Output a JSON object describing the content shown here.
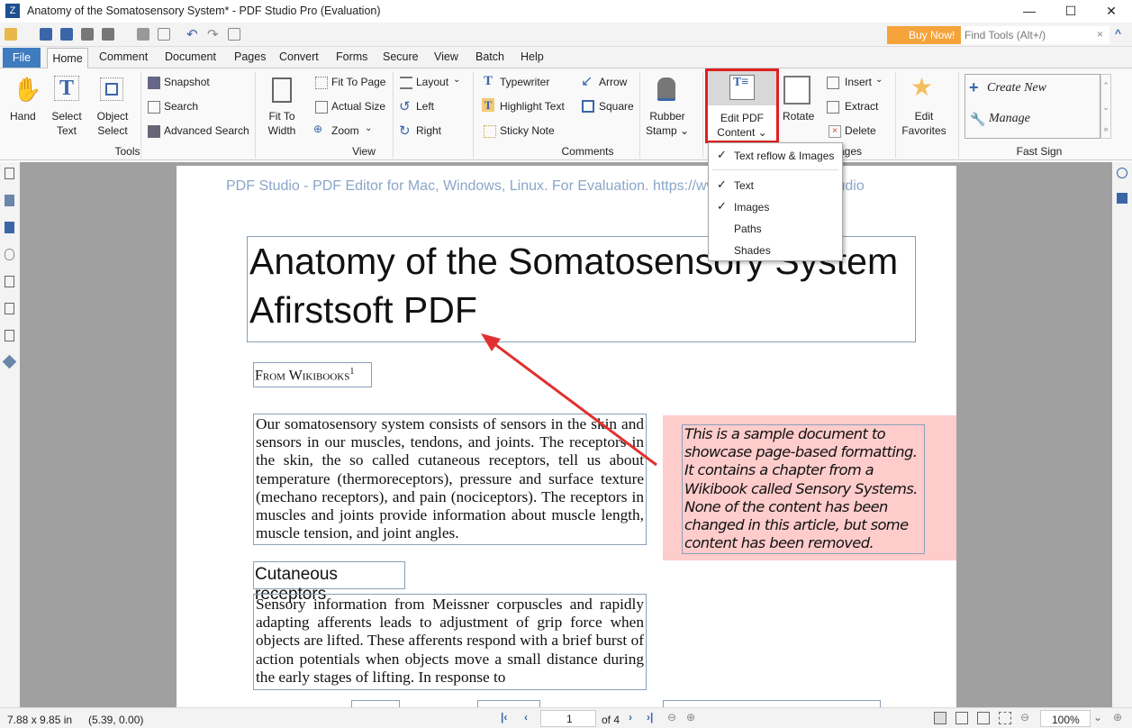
{
  "window": {
    "title": "Anatomy of the Somatosensory System* - PDF Studio Pro (Evaluation)",
    "minimize": "—",
    "maximize": "☐",
    "close": "✕"
  },
  "quick_toolbar": {
    "buy_now": "Buy Now!",
    "find_tools_placeholder": "Find Tools  (Alt+/)",
    "clear": "×",
    "collapse": "^"
  },
  "tabs": [
    "File",
    "Home",
    "Comment",
    "Document",
    "Pages",
    "Convert",
    "Forms",
    "Secure",
    "View",
    "Batch",
    "Help"
  ],
  "ribbon": {
    "tools": {
      "label": "Tools",
      "hand": "Hand",
      "select_text": [
        "Select",
        "Text"
      ],
      "object_select": [
        "Object",
        "Select"
      ],
      "snapshot": "Snapshot",
      "search": "Search",
      "advanced_search": "Advanced Search"
    },
    "view": {
      "label": "View",
      "fit_to_width": [
        "Fit To",
        "Width"
      ],
      "fit_to_page": "Fit To Page",
      "actual_size": "Actual Size",
      "zoom": "Zoom",
      "layout": "Layout",
      "left": "Left",
      "right": "Right"
    },
    "comments": {
      "label": "Comments",
      "typewriter": "Typewriter",
      "highlight_text": "Highlight Text",
      "sticky_note": "Sticky Note",
      "arrow": "Arrow",
      "square": "Square",
      "rubber_stamp": [
        "Rubber",
        "Stamp"
      ]
    },
    "pages": {
      "label": "Pages",
      "edit_pdf_content": [
        "Edit PDF",
        "Content"
      ],
      "rotate": "Rotate",
      "insert": "Insert",
      "extract": "Extract",
      "delete": "Delete",
      "edit_favorites": [
        "Edit",
        "Favorites"
      ]
    },
    "fast_sign": {
      "label": "Fast Sign",
      "create_new": "Create New",
      "manage": "Manage"
    }
  },
  "dropdown": {
    "items": [
      {
        "label": "Text reflow & Images",
        "checked": true
      },
      {
        "label": "Text",
        "checked": true
      },
      {
        "label": "Images",
        "checked": true
      },
      {
        "label": "Paths",
        "checked": false
      },
      {
        "label": "Shades",
        "checked": false
      }
    ]
  },
  "document": {
    "watermark": "PDF Studio - PDF Editor for Mac, Windows, Linux. For Evaluation. https://www.qoppa.com/pdfstudio",
    "title_line1": "Anatomy of the Somatosensory System",
    "title_line2": "Afirstsoft PDF",
    "from": "From Wikibooks",
    "from_sup": "1",
    "para1": "Our somatosensory system consists of sensors in the skin and sensors in our muscles, tendons, and joints. The receptors in the skin, the so called cutaneous receptors, tell us about temperature (thermoreceptors), pressure and surface texture (mechano receptors), and pain (nociceptors). The receptors in muscles and joints provide information about muscle length, muscle tension, and joint angles.",
    "note": "This is a sample document to showcase page-based formatting. It contains a chapter from a Wikibook called Sensory Systems. None of the content has been changed in this article, but some content has been removed.",
    "heading2": "Cutaneous receptors",
    "para2": "Sensory information from Meissner corpuscles and rapidly adapting afferents leads to adjustment of grip force when objects are lifted. These afferents respond with a brief burst of action potentials when objects move a small distance during the early stages of lifting. In response to",
    "note_color": "#ffcccc"
  },
  "status": {
    "page_size": "7.88 x 9.85 in",
    "coords": "(5.39, 0.00)",
    "page": "1",
    "of_pages": "of 4",
    "zoom": "100%"
  },
  "colors": {
    "accent": "#3f7bbf",
    "highlight_box": "#e02020",
    "buy": "#f5a33a",
    "arrow": "#e03030"
  }
}
